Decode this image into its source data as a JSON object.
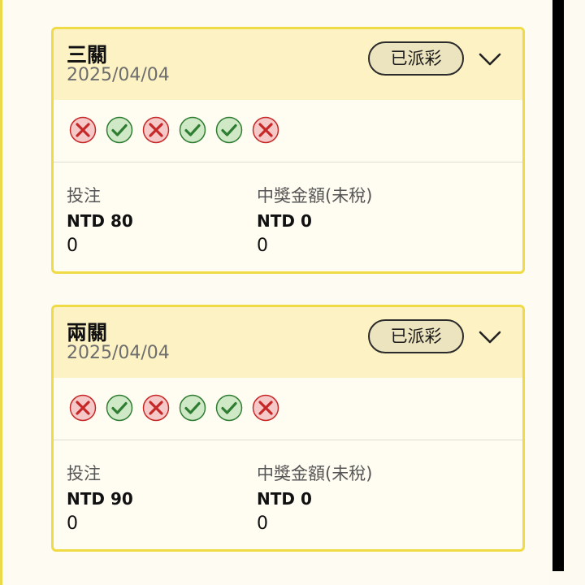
{
  "cards": [
    {
      "title": "三關",
      "date": "2025/04/04",
      "status": "已派彩",
      "results": [
        "loss",
        "win",
        "loss",
        "win",
        "win",
        "loss"
      ],
      "bet_label": "投注",
      "bet_amount": "NTD 80",
      "bet_extra": "0",
      "prize_label": "中獎金額(未稅)",
      "prize_amount": "NTD 0",
      "prize_extra": "0"
    },
    {
      "title": "兩關",
      "date": "2025/04/04",
      "status": "已派彩",
      "results": [
        "loss",
        "win",
        "loss",
        "win",
        "win",
        "loss"
      ],
      "bet_label": "投注",
      "bet_amount": "NTD 90",
      "bet_extra": "0",
      "prize_label": "中獎金額(未稅)",
      "prize_amount": "NTD 0",
      "prize_extra": "0"
    }
  ],
  "colors": {
    "card_border": "#efdb45",
    "header_bg": "#fcf2c4",
    "win_green": "#2f7d32",
    "loss_red": "#c62828"
  }
}
